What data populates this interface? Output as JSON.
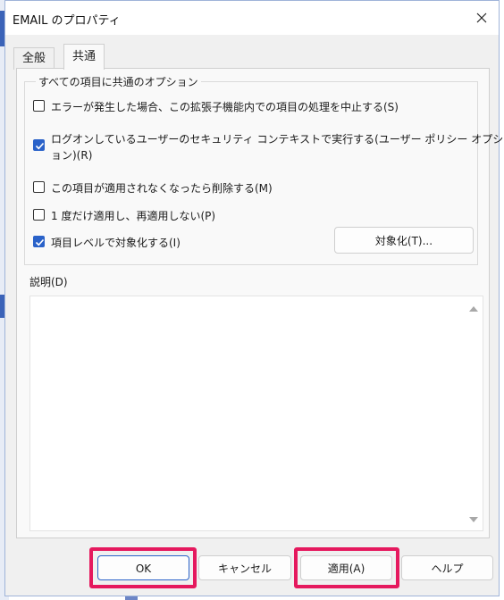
{
  "window": {
    "title": "EMAIL のプロパティ"
  },
  "tabs": [
    {
      "label": "全般",
      "active": false
    },
    {
      "label": "共通",
      "active": true
    }
  ],
  "options_group": {
    "title": "すべての項目に共通のオプション",
    "items": [
      {
        "label": "エラーが発生した場合、この拡張子機能内での項目の処理を中止する(S)",
        "checked": false
      },
      {
        "label_line1": "ログオンしているユーザーのセキュリティ コンテキストで実行する(ユーザー ポリシー オプシ",
        "label_line2": "ョン)(R)",
        "checked": true
      },
      {
        "label": "この項目が適用されなくなったら削除する(M)",
        "checked": false
      },
      {
        "label": "1 度だけ適用し、再適用しない(P)",
        "checked": false
      },
      {
        "label": "項目レベルで対象化する(I)",
        "checked": true
      }
    ],
    "targeting_button": "対象化(T)..."
  },
  "description": {
    "label": "説明(D)",
    "value": ""
  },
  "buttons": {
    "ok": "OK",
    "cancel": "キャンセル",
    "apply": "適用(A)",
    "help": "ヘルプ"
  },
  "colors": {
    "highlight": "#e5195e",
    "checkbox_checked": "#2a62c9"
  }
}
